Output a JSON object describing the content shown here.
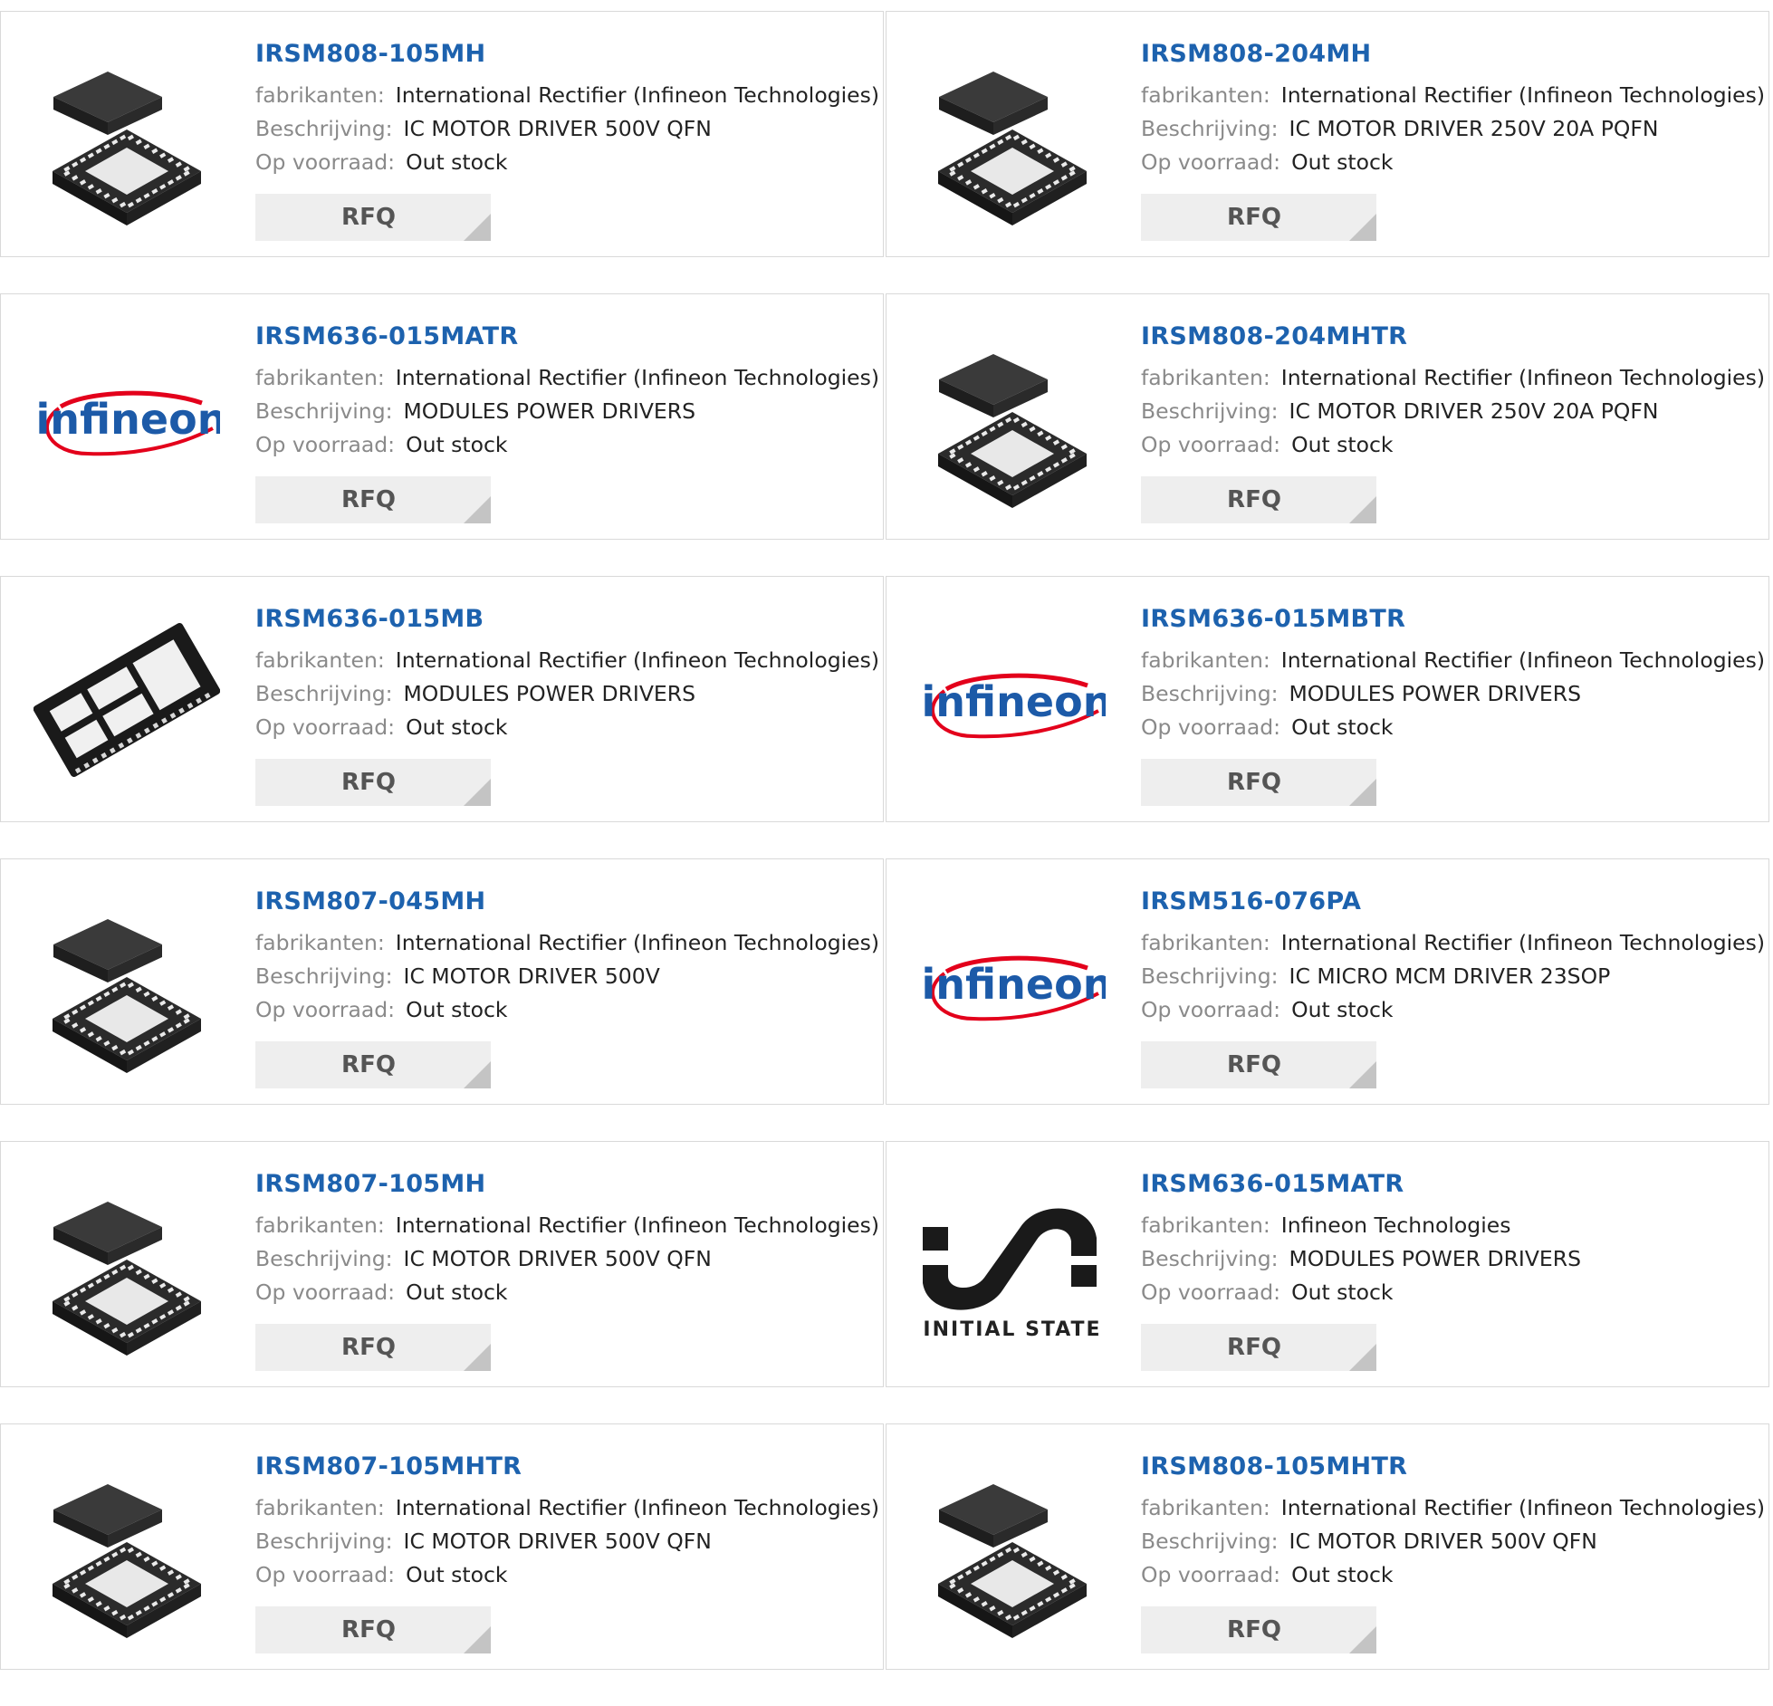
{
  "labels": {
    "manufacturer": "fabrikanten:",
    "description": "Beschrijving:",
    "stock": "Op voorraad:",
    "rfq": "RFQ"
  },
  "logos": {
    "infineon_text": "infineon",
    "initial_state_text": "INITIAL STATE"
  },
  "colors": {
    "part_link": "#1d62ae",
    "label_grey": "#8a8a8a",
    "infineon_blue": "#1c5aa8",
    "infineon_red": "#e3001b"
  },
  "products": [
    {
      "part": "IRSM808-105MH",
      "manufacturer": "International Rectifier (Infineon Technologies)",
      "description": "IC MOTOR DRIVER 500V QFN",
      "stock": "Out stock",
      "image": "qfn-chip-icon"
    },
    {
      "part": "IRSM808-204MH",
      "manufacturer": "International Rectifier (Infineon Technologies)",
      "description": "IC MOTOR DRIVER 250V 20A PQFN",
      "stock": "Out stock",
      "image": "qfn-chip-icon"
    },
    {
      "part": "IRSM636-015MATR",
      "manufacturer": "International Rectifier (Infineon Technologies)",
      "description": "MODULES POWER DRIVERS",
      "stock": "Out stock",
      "image": "infineon-logo"
    },
    {
      "part": "IRSM808-204MHTR",
      "manufacturer": "International Rectifier (Infineon Technologies)",
      "description": "IC MOTOR DRIVER 250V 20A PQFN",
      "stock": "Out stock",
      "image": "qfn-chip-icon"
    },
    {
      "part": "IRSM636-015MB",
      "manufacturer": "International Rectifier (Infineon Technologies)",
      "description": "MODULES POWER DRIVERS",
      "stock": "Out stock",
      "image": "power-module-chip-icon"
    },
    {
      "part": "IRSM636-015MBTR",
      "manufacturer": "International Rectifier (Infineon Technologies)",
      "description": "MODULES POWER DRIVERS",
      "stock": "Out stock",
      "image": "infineon-logo"
    },
    {
      "part": "IRSM807-045MH",
      "manufacturer": "International Rectifier (Infineon Technologies)",
      "description": "IC MOTOR DRIVER 500V",
      "stock": "Out stock",
      "image": "qfn-chip-icon"
    },
    {
      "part": "IRSM516-076PA",
      "manufacturer": "International Rectifier (Infineon Technologies)",
      "description": "IC MICRO MCM DRIVER 23SOP",
      "stock": "Out stock",
      "image": "infineon-logo"
    },
    {
      "part": "IRSM807-105MH",
      "manufacturer": "International Rectifier (Infineon Technologies)",
      "description": "IC MOTOR DRIVER 500V QFN",
      "stock": "Out stock",
      "image": "qfn-chip-icon"
    },
    {
      "part": "IRSM636-015MATR",
      "manufacturer": "Infineon Technologies",
      "description": "MODULES POWER DRIVERS",
      "stock": "Out stock",
      "image": "initial-state-logo"
    },
    {
      "part": "IRSM807-105MHTR",
      "manufacturer": "International Rectifier (Infineon Technologies)",
      "description": "IC MOTOR DRIVER 500V QFN",
      "stock": "Out stock",
      "image": "qfn-chip-icon"
    },
    {
      "part": "IRSM808-105MHTR",
      "manufacturer": "International Rectifier (Infineon Technologies)",
      "description": "IC MOTOR DRIVER 500V QFN",
      "stock": "Out stock",
      "image": "qfn-chip-icon"
    }
  ]
}
